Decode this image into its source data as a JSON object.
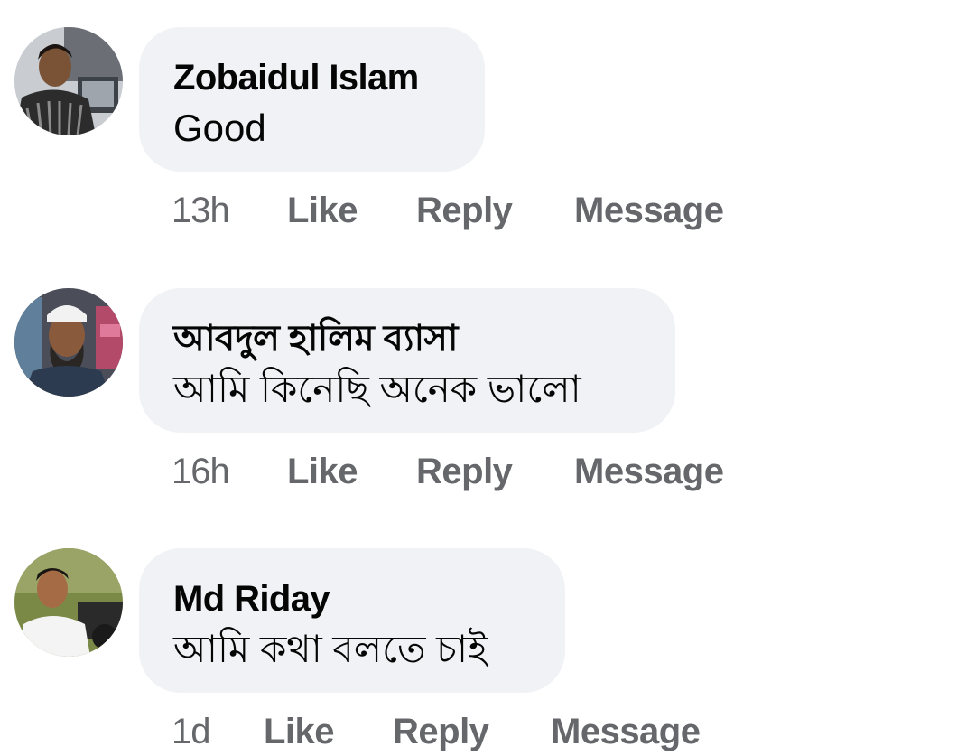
{
  "comments": [
    {
      "author": "Zobaidul Islam",
      "text": "Good",
      "time": "13h",
      "actions": {
        "like": "Like",
        "reply": "Reply",
        "message": "Message"
      },
      "avatar_bg": "#8a8f98"
    },
    {
      "author": "আবদুল হালিম ব্যাসা",
      "text": "আমি কিনেছি অনেক ভালো",
      "time": "16h",
      "actions": {
        "like": "Like",
        "reply": "Reply",
        "message": "Message"
      },
      "avatar_bg": "#6d6a6e"
    },
    {
      "author": "Md Riday",
      "text": "আমি কথা বলতে চাই",
      "time": "1d",
      "actions": {
        "like": "Like",
        "reply": "Reply",
        "message": "Message"
      },
      "avatar_bg": "#7e8a4c"
    }
  ],
  "colors": {
    "bubble": "#f0f2f5",
    "meta": "#65676b",
    "text": "#050505"
  }
}
